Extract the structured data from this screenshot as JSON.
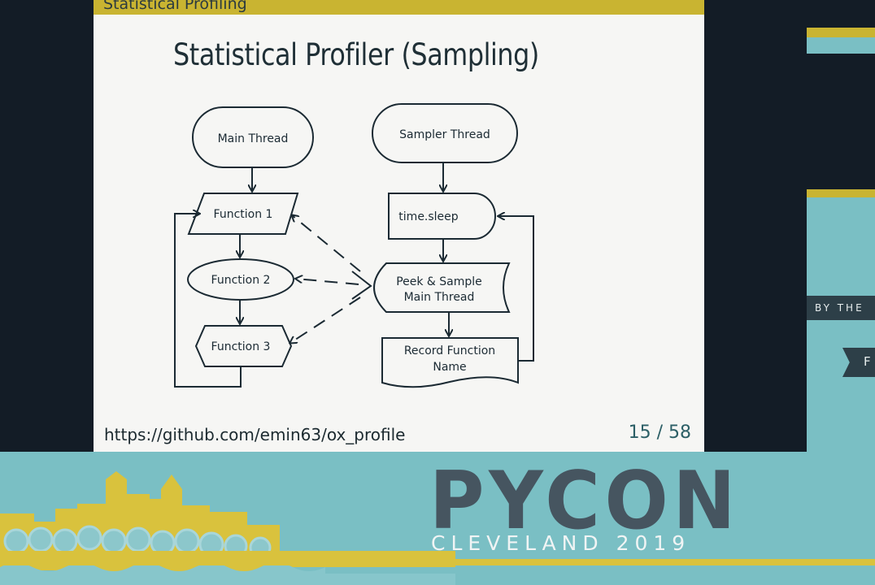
{
  "slide": {
    "section_title": "Statistical Profiling",
    "title": "Statistical Profiler (Sampling)",
    "link": "https://github.com/emin63/ox_profile",
    "page": "15 / 58"
  },
  "diagram": {
    "main_thread": "Main Thread",
    "sampler_thread": "Sampler Thread",
    "function_1": "Function 1",
    "function_2": "Function 2",
    "function_3": "Function 3",
    "time_sleep": "time.sleep",
    "peek_line1": "Peek & Sample",
    "peek_line2": "Main Thread",
    "record_line1": "Record Function",
    "record_line2": "Name"
  },
  "banner": {
    "logo_text": "PYCON",
    "location": "CLEVELAND 2019"
  },
  "side_panel": {
    "text_1": "BY THE",
    "text_2": "F"
  },
  "colors": {
    "accent_yellow": "#c9b431",
    "banner_teal": "#7abfc4",
    "logo_gray": "#465560",
    "page_teal": "#2c5f66",
    "background": "#131c26"
  }
}
